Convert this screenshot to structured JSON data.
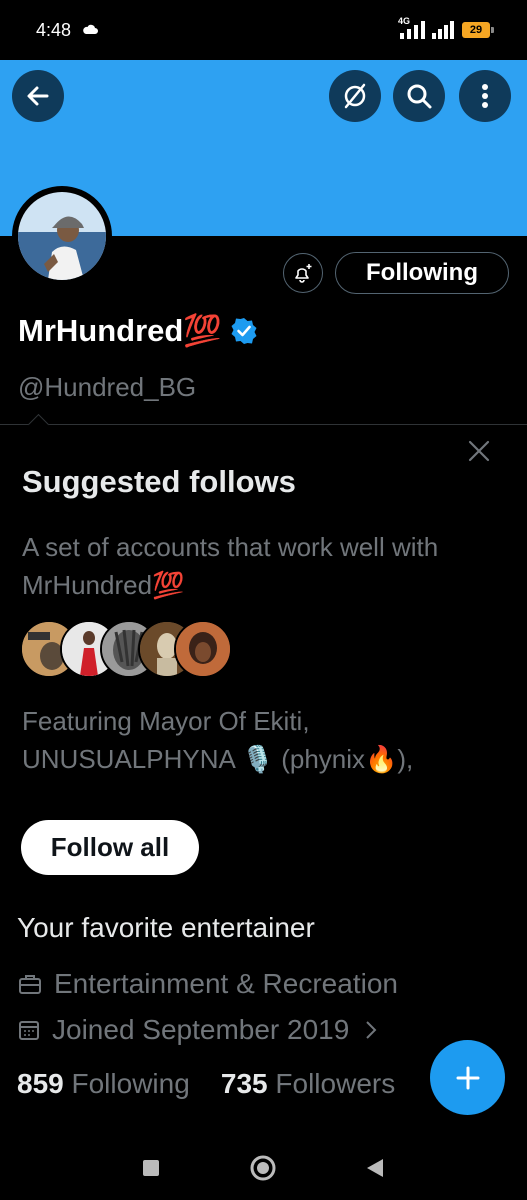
{
  "status_bar": {
    "time": "4:48",
    "network": "4G",
    "battery": "29"
  },
  "header": {
    "back_icon": "arrow-left-icon",
    "grok_icon": "slash-circle-icon",
    "search_icon": "search-icon",
    "more_icon": "more-vertical-icon",
    "banner_color": "#2ea1f2"
  },
  "profile": {
    "name": "MrHundred💯",
    "handle": "@Hundred_BG",
    "following_button": "Following",
    "bio": "Your favorite entertainer",
    "category": "Entertainment & Recreation",
    "joined": "Joined September 2019",
    "following_count": "859",
    "following_label": "Following",
    "followers_count": "735",
    "followers_label": "Followers"
  },
  "suggested": {
    "title": "Suggested follows",
    "description": "A set of accounts that work well with MrHundred💯",
    "featuring": "Featuring Mayor Of Ekiti, UNUSUALPHYNA 🎙️ (phynix🔥),",
    "follow_all": "Follow all"
  },
  "colors": {
    "accent": "#1d9bf0",
    "muted": "#71767b",
    "background": "#000000"
  }
}
